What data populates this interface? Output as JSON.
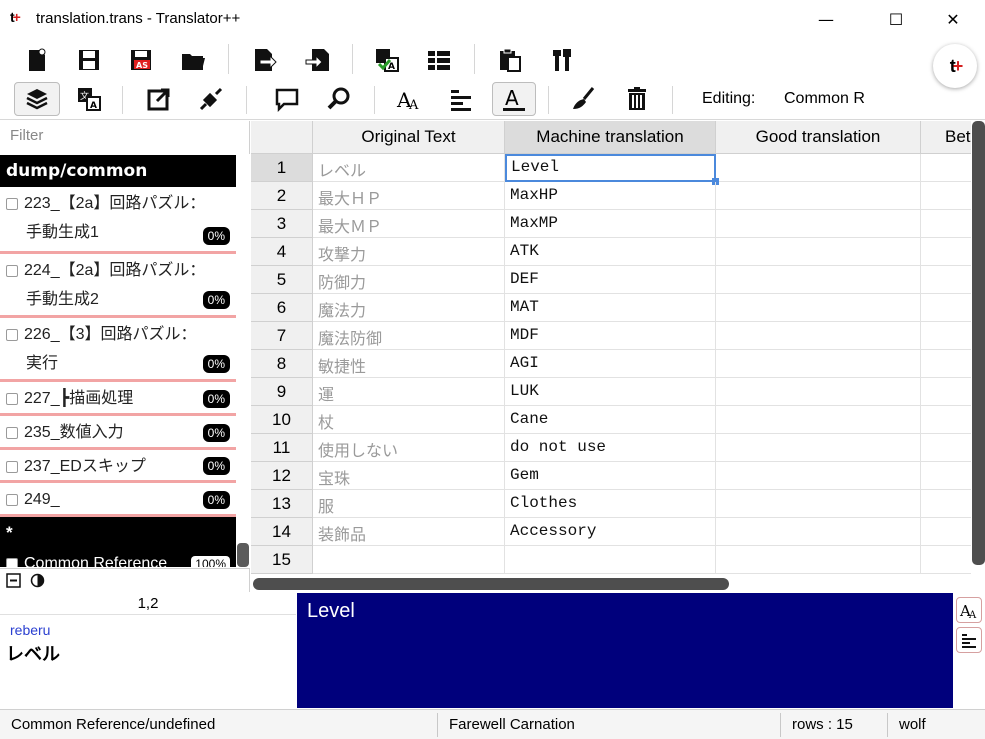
{
  "window": {
    "title": "translation.trans - Translator++",
    "minimize": "—",
    "maximize": "☐",
    "close": "✕"
  },
  "toolbar": {
    "editing_label": "Editing:",
    "editing_value": "Common R",
    "icons_row1": [
      "new-project-icon",
      "save-icon",
      "save-as-icon",
      "open-folder-icon",
      "export-icon",
      "import-icon",
      "translate-check-icon",
      "list-view-icon",
      "clipboard-icon",
      "tools-icon"
    ],
    "icons_row2": [
      "layers-icon",
      "translate-icon",
      "edit-external-icon",
      "plugin-icon",
      "comment-icon",
      "search-icon",
      "font-size-icon",
      "align-icon",
      "text-color-icon",
      "brush-icon",
      "trash-icon"
    ]
  },
  "sidebar": {
    "filter_placeholder": "Filter",
    "group1": "dump/common",
    "items": [
      {
        "line1": "223_【2a】回路パズル：",
        "line2": "手動生成1",
        "pct": "0%"
      },
      {
        "line1": "224_【2a】回路パズル：",
        "line2": "手動生成2",
        "pct": "0%"
      },
      {
        "line1": "226_【3】回路パズル：",
        "line2": "実行",
        "pct": "0%"
      },
      {
        "line1": "227_┣描画処理",
        "pct": "0%"
      },
      {
        "line1": "235_数値入力",
        "pct": "0%"
      },
      {
        "line1": "237_EDスキップ",
        "pct": "0%"
      },
      {
        "line1": "249_",
        "pct": "0%"
      }
    ],
    "group2": "*",
    "common_reference": {
      "label": "Common Reference",
      "pct": "100%"
    }
  },
  "grid": {
    "columns": [
      "Original Text",
      "Machine translation",
      "Good translation",
      "Bet"
    ],
    "rows": [
      {
        "n": "1",
        "orig": "レベル",
        "mt": "Level"
      },
      {
        "n": "2",
        "orig": "最大ＨＰ",
        "mt": "MaxHP"
      },
      {
        "n": "3",
        "orig": "最大ＭＰ",
        "mt": "MaxMP"
      },
      {
        "n": "4",
        "orig": "攻撃力",
        "mt": "ATK"
      },
      {
        "n": "5",
        "orig": "防御力",
        "mt": "DEF"
      },
      {
        "n": "6",
        "orig": "魔法力",
        "mt": "MAT"
      },
      {
        "n": "7",
        "orig": "魔法防御",
        "mt": "MDF"
      },
      {
        "n": "8",
        "orig": "敏捷性",
        "mt": "AGI"
      },
      {
        "n": "9",
        "orig": "運",
        "mt": "LUK"
      },
      {
        "n": "10",
        "orig": "杖",
        "mt": "Cane"
      },
      {
        "n": "11",
        "orig": "使用しない",
        "mt": "do not use"
      },
      {
        "n": "12",
        "orig": "宝珠",
        "mt": "Gem"
      },
      {
        "n": "13",
        "orig": "服",
        "mt": "Clothes"
      },
      {
        "n": "14",
        "orig": "装飾品",
        "mt": "Accessory"
      },
      {
        "n": "15",
        "orig": "",
        "mt": ""
      }
    ]
  },
  "detail": {
    "cell_ref": "1,2",
    "romaji": "reberu",
    "word": "レベル",
    "editor_text": "Level"
  },
  "status": {
    "path": "Common Reference/undefined",
    "project": "Farewell Carnation",
    "rows": "rows : 15",
    "engine": "wolf"
  },
  "colors": {
    "editor_bg": "#00007c",
    "selection": "#4b89dc",
    "item_border": "#f2a4a4",
    "romaji": "#2a3fd0"
  }
}
